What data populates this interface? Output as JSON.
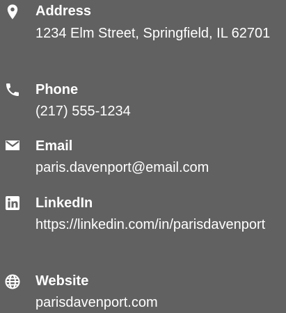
{
  "contact": {
    "address": {
      "icon": "map-marker-icon",
      "label": "Address",
      "value": "1234 Elm Street, Springfield, IL 62701"
    },
    "phone": {
      "icon": "phone-icon",
      "label": "Phone",
      "value": "(217) 555-1234"
    },
    "email": {
      "icon": "envelope-icon",
      "label": "Email",
      "value": "paris.davenport@email.com"
    },
    "linkedin": {
      "icon": "linkedin-icon",
      "label": "LinkedIn",
      "value": "https://linkedin.com/in/parisdavenport"
    },
    "website": {
      "icon": "globe-icon",
      "label": "Website",
      "value": "parisdavenport.com"
    }
  },
  "colors": {
    "background": "#616161",
    "text": "#ffffff"
  }
}
